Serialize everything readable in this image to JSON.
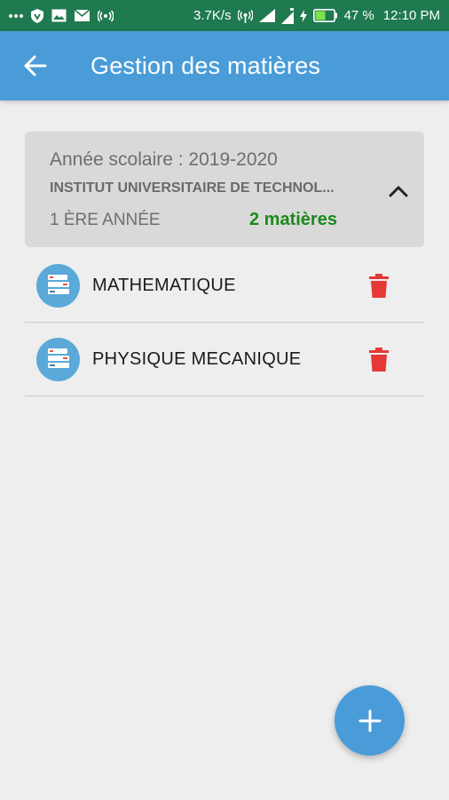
{
  "status_bar": {
    "network_speed": "3.7K/s",
    "battery_percent": "47 %",
    "time": "12:10 PM",
    "icons": [
      "more-dots-icon",
      "shield-icon",
      "image-icon",
      "mail-icon",
      "hotspot-icon",
      "wifi-icon",
      "signal-icon",
      "signal-icon",
      "charging-icon",
      "battery-icon"
    ]
  },
  "app_bar": {
    "title": "Gestion des matières",
    "back_icon": "arrow-back-icon",
    "color": "#4a9cd8"
  },
  "group": {
    "year": "Année scolaire : 2019-2020",
    "institution": "INSTITUT UNIVERSITAIRE DE TECHNOL...",
    "level": "1 ÈRE ANNÉE",
    "count": "2 matières",
    "count_color": "#1b8a1b",
    "expanded_icon": "chevron-up-icon"
  },
  "subjects": [
    {
      "name": "MATHEMATIQUE",
      "icon": "books-icon",
      "action_icon": "trash-icon"
    },
    {
      "name": "PHYSIQUE MECANIQUE",
      "icon": "books-icon",
      "action_icon": "trash-icon"
    }
  ],
  "fab": {
    "icon": "plus-icon"
  },
  "colors": {
    "status_bar": "#1f7a4f",
    "delete": "#e53935",
    "background": "#eeeeee"
  }
}
